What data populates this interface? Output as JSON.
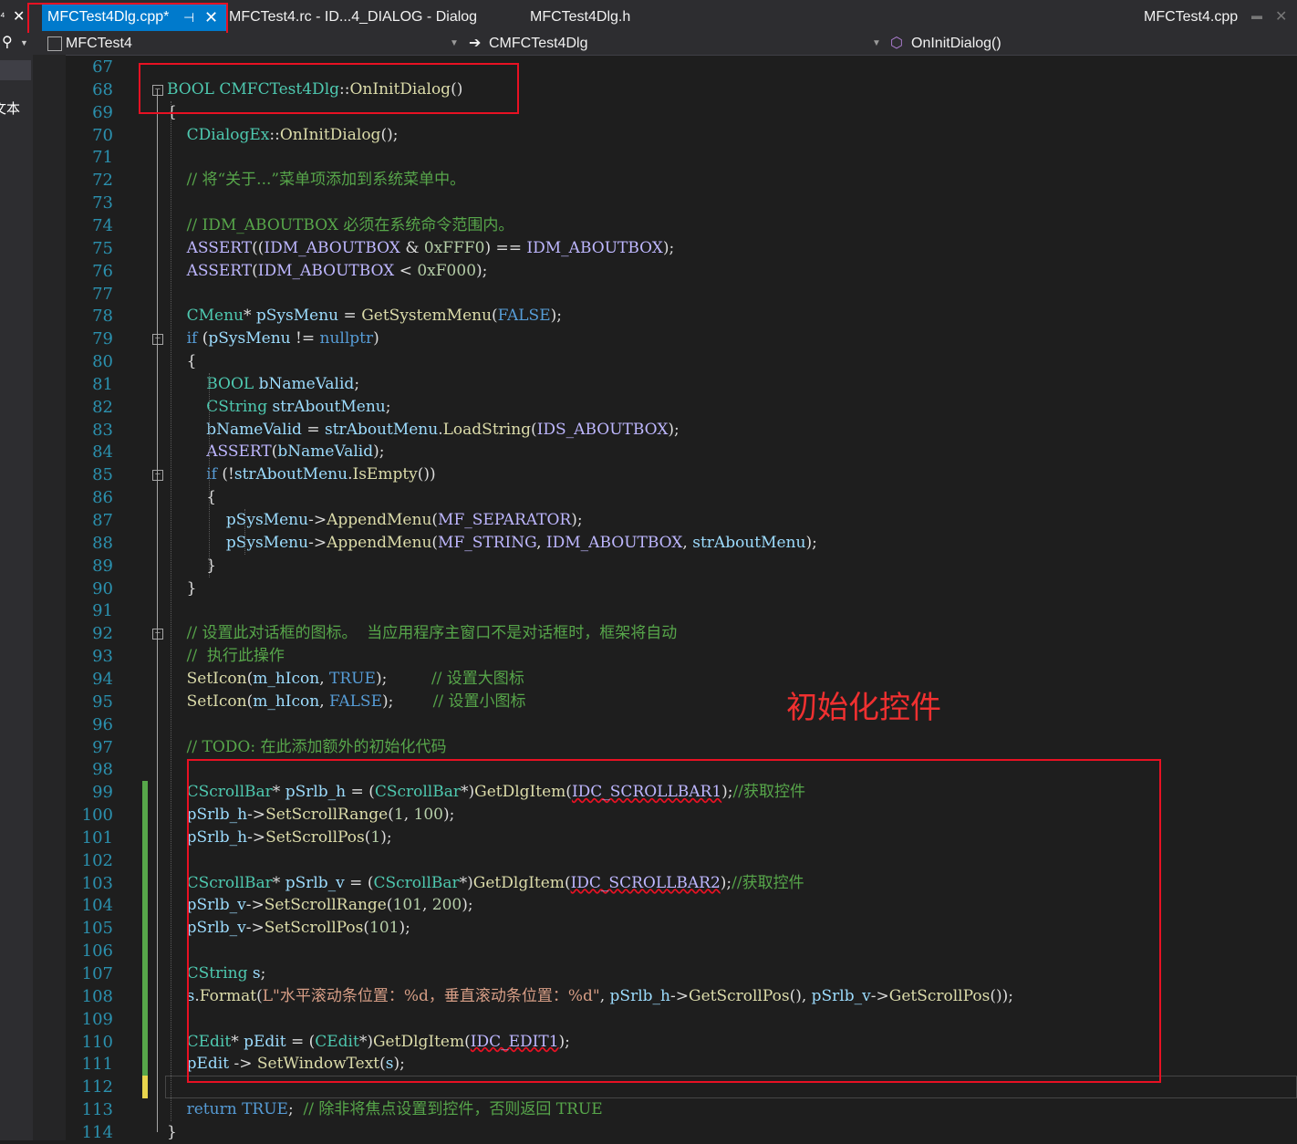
{
  "tabs": [
    {
      "label": "MFCTest4Dlg.cpp*",
      "active": true
    },
    {
      "label": "MFCTest4.rc - ID...4_DIALOG - Dialog"
    },
    {
      "label": "MFCTest4Dlg.h"
    },
    {
      "label": "MFCTest4.cpp"
    }
  ],
  "nav": {
    "project": "MFCTest4",
    "class": "CMFCTest4Dlg",
    "method": "OnInitDialog()"
  },
  "sidebar": {
    "label": "文本"
  },
  "annotation": "初始化控件",
  "line_numbers": [
    "67",
    "68",
    "69",
    "70",
    "71",
    "72",
    "73",
    "74",
    "75",
    "76",
    "77",
    "78",
    "79",
    "80",
    "81",
    "82",
    "83",
    "84",
    "85",
    "86",
    "87",
    "88",
    "89",
    "90",
    "91",
    "92",
    "93",
    "94",
    "95",
    "96",
    "97",
    "98",
    "99",
    "100",
    "101",
    "102",
    "103",
    "104",
    "105",
    "106",
    "107",
    "108",
    "109",
    "110",
    "111",
    "112",
    "113",
    "114"
  ],
  "code": [
    "",
    "BOOL CMFCTest4Dlg::OnInitDialog()",
    "{",
    "    CDialogEx::OnInitDialog();",
    "",
    "    // 将“关于...”菜单项添加到系统菜单中。",
    "",
    "    // IDM_ABOUTBOX 必须在系统命令范围内。",
    "    ASSERT((IDM_ABOUTBOX & 0xFFF0) == IDM_ABOUTBOX);",
    "    ASSERT(IDM_ABOUTBOX < 0xF000);",
    "",
    "    CMenu* pSysMenu = GetSystemMenu(FALSE);",
    "    if (pSysMenu != nullptr)",
    "    {",
    "        BOOL bNameValid;",
    "        CString strAboutMenu;",
    "        bNameValid = strAboutMenu.LoadString(IDS_ABOUTBOX);",
    "        ASSERT(bNameValid);",
    "        if (!strAboutMenu.IsEmpty())",
    "        {",
    "            pSysMenu->AppendMenu(MF_SEPARATOR);",
    "            pSysMenu->AppendMenu(MF_STRING, IDM_ABOUTBOX, strAboutMenu);",
    "        }",
    "    }",
    "",
    "    // 设置此对话框的图标。  当应用程序主窗口不是对话框时，框架将自动",
    "    //  执行此操作",
    "    SetIcon(m_hIcon, TRUE);         // 设置大图标",
    "    SetIcon(m_hIcon, FALSE);        // 设置小图标",
    "",
    "    // TODO: 在此添加额外的初始化代码",
    "",
    "    CScrollBar* pSrlb_h = (CScrollBar*)GetDlgItem(IDC_SCROLLBAR1);//获取控件",
    "    pSrlb_h->SetScrollRange(1, 100);",
    "    pSrlb_h->SetScrollPos(1);",
    "",
    "    CScrollBar* pSrlb_v = (CScrollBar*)GetDlgItem(IDC_SCROLLBAR2);//获取控件",
    "    pSrlb_v->SetScrollRange(101, 200);",
    "    pSrlb_v->SetScrollPos(101);",
    "",
    "    CString s;",
    "    s.Format(L\"水平滚动条位置：%d，垂直滚动条位置：%d\", pSrlb_h->GetScrollPos(), pSrlb_v->GetScrollPos());",
    "",
    "    CEdit* pEdit = (CEdit*)GetDlgItem(IDC_EDIT1);",
    "    pEdit -> SetWindowText(s);",
    "",
    "    return TRUE;  // 除非将焦点设置到控件，否则返回 TRUE",
    "}"
  ],
  "colors": {
    "accent": "#007acc",
    "highlight_box": "#e81123",
    "annotation": "#f03030",
    "change_bar": "#57a64a"
  }
}
